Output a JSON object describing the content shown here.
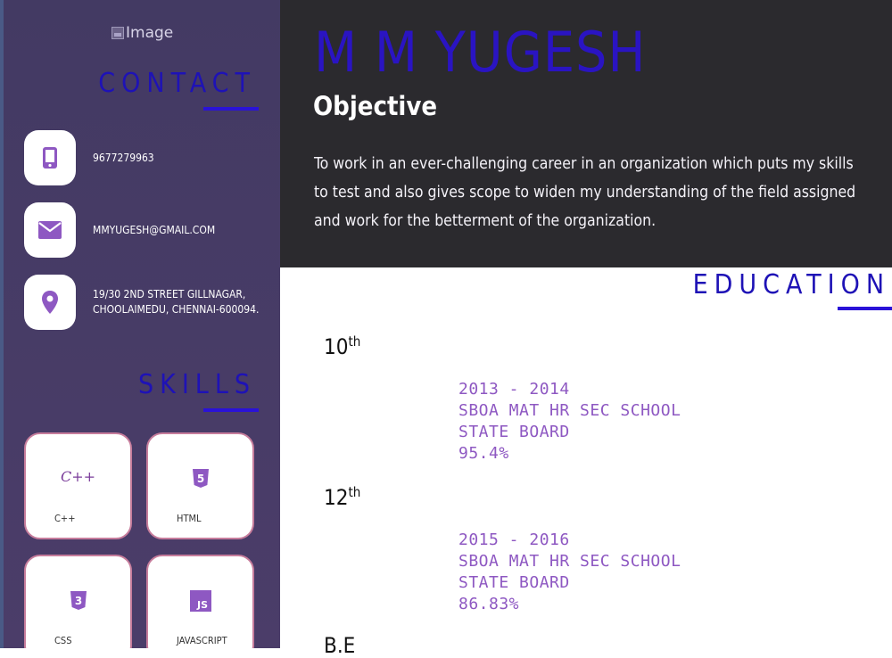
{
  "sidebar": {
    "profile_image_alt": "Image",
    "contact_heading": "CONTACT",
    "contacts": [
      {
        "icon": "phone-icon",
        "text": "9677279963"
      },
      {
        "icon": "mail-icon",
        "text": "MMYUGESH@GMAIL.COM"
      },
      {
        "icon": "location-pin-icon",
        "line1": "19/30 2ND STREET GILLNAGAR,",
        "line2": "CHOOLAIMEDU, CHENNAI-600094."
      }
    ],
    "skills_heading": "SKILLS",
    "skills": [
      {
        "icon_text": "C++",
        "label": "C++"
      },
      {
        "icon_text": "5",
        "label": "HTML"
      },
      {
        "icon_text": "3",
        "label": "CSS"
      },
      {
        "icon_text": "JS",
        "label": "JAVASCRIPT"
      }
    ]
  },
  "header": {
    "name": "M M YUGESH",
    "objective_heading": "Objective",
    "objective_text": "To work in an ever-challenging career in an organization which puts my skills to test and also gives scope to widen my understanding of the field assigned and work for the betterment of the organization."
  },
  "education": {
    "heading": "EDUCATION",
    "entries": [
      {
        "grade": "10",
        "suffix": "th",
        "years": "2013 - 2014",
        "school": "SBOA MAT HR SEC SCHOOL",
        "board": "STATE BOARD",
        "score": "95.4%"
      },
      {
        "grade": "12",
        "suffix": "th",
        "years": "2015 - 2016",
        "school": "SBOA MAT HR SEC SCHOOL",
        "board": "STATE BOARD",
        "score": "86.83%"
      },
      {
        "grade": "B.E",
        "suffix": ""
      }
    ]
  },
  "colors": {
    "sidebar_bg": "#463b66",
    "accent_heading": "#1e12b6",
    "detail_purple": "#8e58c2",
    "header_bg": "#2b2a2e"
  }
}
